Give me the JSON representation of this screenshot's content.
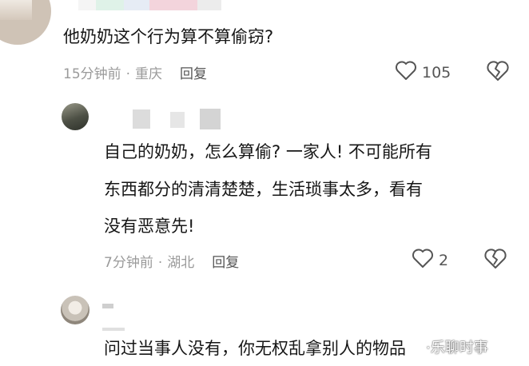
{
  "top_comment": {
    "text": "他奶奶这个行为算不算偷窃?",
    "time": "15分钟前",
    "location": "重庆",
    "reply_label": "回复",
    "like_count": "105"
  },
  "reply_1": {
    "lines": [
      "自己的奶奶，怎么算偷? 一家人! 不可能所有",
      "东西都分的清清楚楚，生活琐事太多，看有",
      "没有恶意先!"
    ],
    "time": "7分钟前",
    "location": "湖北",
    "reply_label": "回复",
    "like_count": "2"
  },
  "reply_2": {
    "text": "问过当事人没有，你无权乱拿别人的物品"
  },
  "meta_separator": "·",
  "watermark": "·乐聊时事",
  "icons": {
    "like": "heart-outline-icon",
    "dislike": "broken-heart-icon"
  },
  "colors": {
    "text": "#161616",
    "meta": "#9a9a9a",
    "icon": "#555555"
  }
}
